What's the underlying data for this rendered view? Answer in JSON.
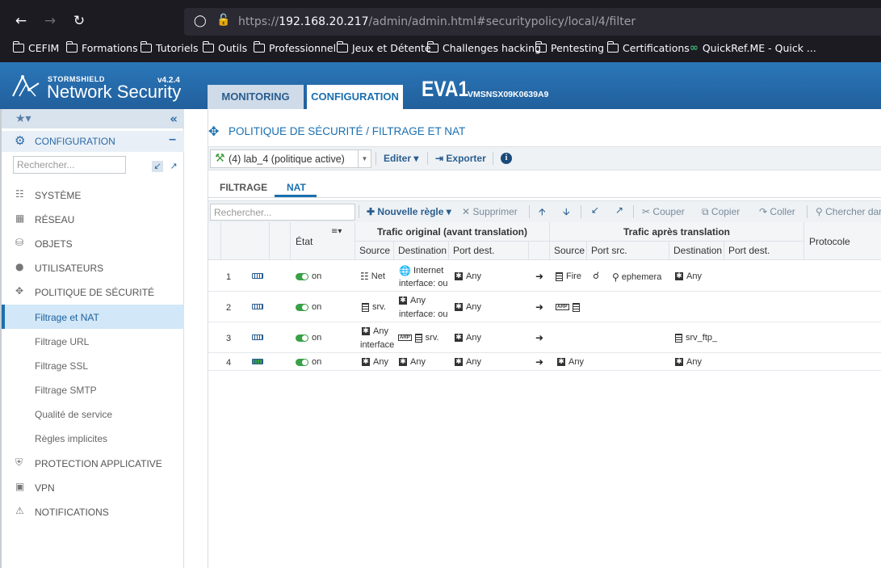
{
  "browser": {
    "url_prefix": "https://",
    "url_host": "192.168.20.217",
    "url_path": "/admin/admin.html#securitypolicy/local/4/filter",
    "bookmarks": [
      "CEFIM",
      "Formations",
      "Tutoriels",
      "Outils",
      "Professionnel",
      "Jeux et Détente",
      "Challenges hacking",
      "Pentesting",
      "Certifications",
      "QuickRef.ME - Quick ..."
    ]
  },
  "header": {
    "brand": "STORMSHIELD",
    "product": "Network Security",
    "version": "v4.2.4",
    "tab_monitoring": "MONITORING",
    "tab_configuration": "CONFIGURATION",
    "firewall_name": "EVA1",
    "firewall_serial": "VMSNSX09K0639A9"
  },
  "sidebar": {
    "section_label": "CONFIGURATION",
    "search_placeholder": "Rechercher...",
    "items": [
      "SYSTÈME",
      "RÉSEAU",
      "OBJETS",
      "UTILISATEURS",
      "POLITIQUE DE SÉCURITÉ"
    ],
    "subitems": [
      "Filtrage et NAT",
      "Filtrage URL",
      "Filtrage SSL",
      "Filtrage SMTP",
      "Qualité de service",
      "Règles implicites"
    ],
    "items_bottom": [
      "PROTECTION APPLICATIVE",
      "VPN",
      "NOTIFICATIONS"
    ]
  },
  "main": {
    "title": "POLITIQUE DE SÉCURITÉ / FILTRAGE ET NAT",
    "policy_select": "(4) lab_4 (politique active)",
    "edit": "Editer",
    "export": "Exporter",
    "tab_filtrage": "FILTRAGE",
    "tab_nat": "NAT",
    "search_placeholder": "Rechercher...",
    "new_rule": "Nouvelle règle",
    "delete": "Supprimer",
    "cut": "Couper",
    "copy": "Copier",
    "paste": "Coller",
    "search_in": "Chercher dar"
  },
  "table": {
    "col_state": "État",
    "group_original": "Trafic original (avant translation)",
    "group_after": "Trafic après translation",
    "col_protocol": "Protocole",
    "col_source": "Source",
    "col_destination": "Destination",
    "col_port_dest": "Port dest.",
    "col_source2": "Source",
    "col_port_src": "Port src.",
    "col_destination2": "Destination",
    "col_port_dest2": "Port dest.",
    "rows": [
      {
        "num": "1",
        "state": "on",
        "src": "Net",
        "dst_line1": "Internet",
        "dst_line2": "interface: ou",
        "port": "Any",
        "t_src": "Fire",
        "t_port_src": "ephemera",
        "t_dst": "Any"
      },
      {
        "num": "2",
        "state": "on",
        "src": "srv.",
        "dst_line1": "Any",
        "dst_line2": "interface: ou",
        "port": "Any",
        "t_src": "",
        "t_port_src": "",
        "t_dst": ""
      },
      {
        "num": "3",
        "state": "on",
        "src_line1": "Any",
        "src_line2": "interface",
        "dst": "srv.",
        "port": "Any",
        "t_src": "",
        "t_port_src": "",
        "t_dst": "srv_ftp_"
      },
      {
        "num": "4",
        "state": "on",
        "src": "Any",
        "dst": "Any",
        "port": "Any",
        "t_src": "Any",
        "t_port_src": "",
        "t_dst": "Any"
      }
    ]
  }
}
